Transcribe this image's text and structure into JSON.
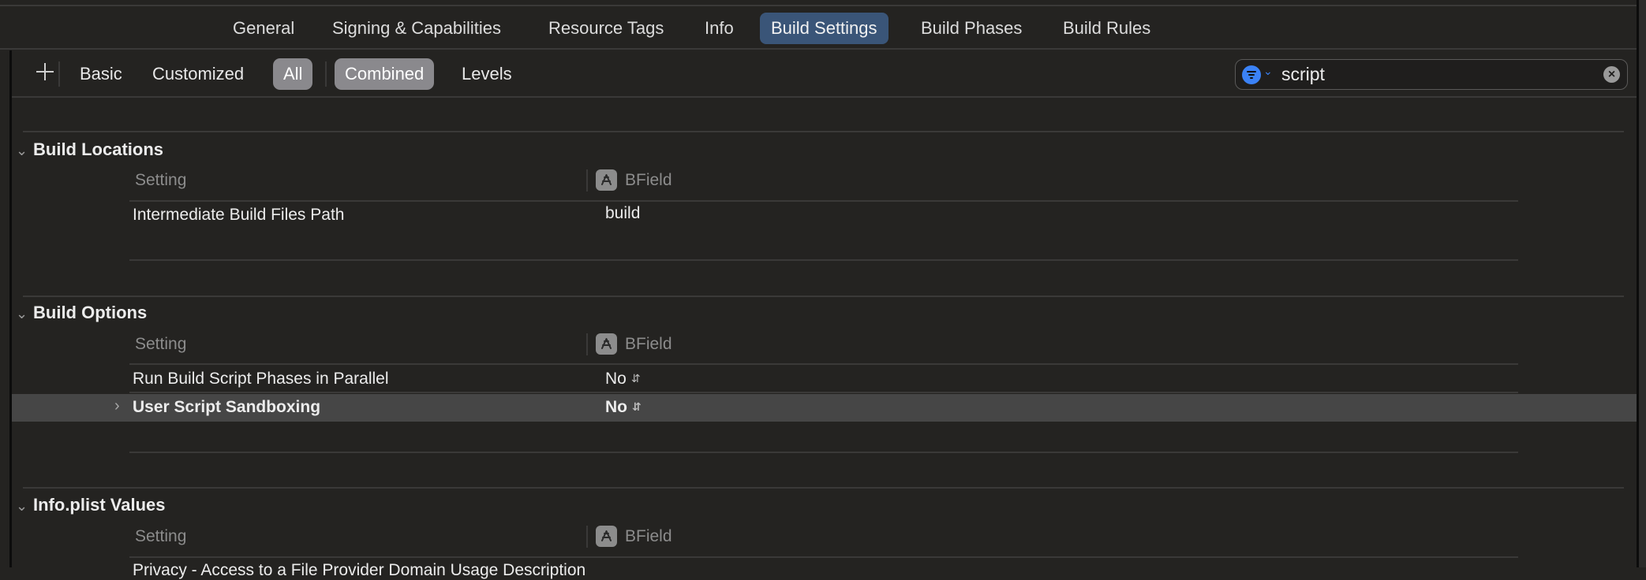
{
  "tabs": [
    {
      "label": "General",
      "active": false
    },
    {
      "label": "Signing & Capabilities",
      "active": false
    },
    {
      "label": "Resource Tags",
      "active": false
    },
    {
      "label": "Info",
      "active": false
    },
    {
      "label": "Build Settings",
      "active": true
    },
    {
      "label": "Build Phases",
      "active": false
    },
    {
      "label": "Build Rules",
      "active": false
    }
  ],
  "filterbar": {
    "add_icon": "plus-icon",
    "scope": [
      {
        "label": "Basic",
        "selected": false
      },
      {
        "label": "Customized",
        "selected": false
      },
      {
        "label": "All",
        "selected": true
      }
    ],
    "view": [
      {
        "label": "Combined",
        "selected": true
      },
      {
        "label": "Levels",
        "selected": false
      }
    ],
    "search": {
      "value": "script",
      "filter_icon": "filter-icon",
      "clear_icon": "clear-icon",
      "accent": "#3b82f6"
    }
  },
  "sections": [
    {
      "title": "Build Locations",
      "column_header": "Setting",
      "target": "BField",
      "rows": [
        {
          "label": "Intermediate Build Files Path",
          "value": "build"
        }
      ]
    },
    {
      "title": "Build Options",
      "column_header": "Setting",
      "target": "BField",
      "rows": [
        {
          "label": "Run Build Script Phases in Parallel",
          "value": "No"
        },
        {
          "label": "User Script Sandboxing",
          "value": "No",
          "selected": true,
          "bold": true
        }
      ]
    },
    {
      "title": "Info.plist Values",
      "column_header": "Setting",
      "target": "BField",
      "rows": [
        {
          "label": "Privacy - Access to a File Provider Domain Usage Description",
          "value": ""
        }
      ]
    }
  ],
  "colors": {
    "background": "#242321",
    "active_tab": "#3a5578",
    "selected_pill": "#8a898d",
    "selected_row": "#464646"
  }
}
